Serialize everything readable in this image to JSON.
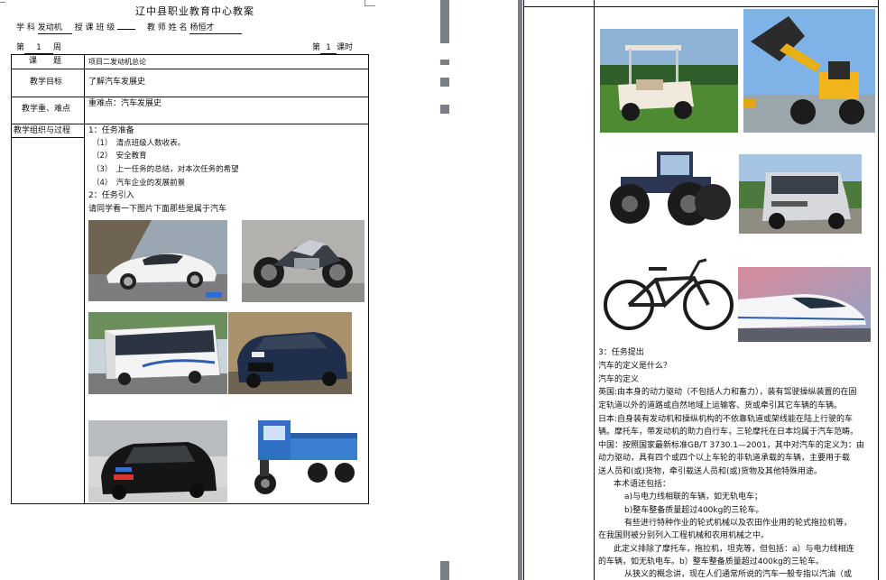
{
  "left_page": {
    "title": "辽中县职业教育中心教案",
    "meta": {
      "subject_label": "学 科",
      "subject_value": "发动机",
      "class_label": "授 课 班 级",
      "class_value": "",
      "teacher_label": "教 师 姓 名",
      "teacher_value": "杨恒才"
    },
    "week": {
      "prefix": "第",
      "value": "1",
      "suffix": "周"
    },
    "period": {
      "prefix": "第",
      "value": "1",
      "suffix": "课时"
    },
    "rows": [
      {
        "label": "课　　题",
        "value": "项目二发动机总论"
      },
      {
        "label": "教学目标",
        "value": "了解汽车发展史"
      },
      {
        "label": "教学重、难点",
        "value": "重难点：汽车发展史"
      },
      {
        "label": "教学组织与过程",
        "value": ""
      }
    ],
    "process": [
      "1：任务准备",
      "（1）　清点班级人数收表。",
      "（2）　安全教育",
      "（3）　上一任务的总结，对本次任务的希望",
      "（4）　汽车企业的发展前景",
      "2：任务引入",
      "请同学看一下图片下面那些是属于汽车"
    ]
  },
  "right_page": {
    "section": "3：任务提出",
    "paragraphs": [
      "汽车的定义是什么？",
      "汽车的定义",
      "英国:由本身的动力驱动（不包括人力和畜力），装有驾驶操纵装置的在固",
      "定轨道以外的道路或自然地域上运输客、货或牵引其它车辆的车辆。",
      "日本:自身装有发动机和操纵机构的不依靠轨道或架线能在陆上行驶的车",
      "辆。摩托车，带发动机的助力自行车，三轮摩托在日本均属于汽车范畴。",
      "中国：按照国家最新标准GB/T 3730.1—2001，其中对汽车的定义为：由",
      "动力驱动，具有四个或四个以上车轮的非轨道承载的车辆，主要用于载",
      "送人员和(或)货物，牵引载送人员和(或)货物及其他特殊用途。",
      "本术语还包括：",
      "a)与电力线相联的车辆，如无轨电车；",
      "b)整车整备质量超过400kg的三轮车。",
      "有些进行特种作业的轮式机械以及农田作业用的轮式拖拉机等，",
      "在我国则被分别列入工程机械和农用机械之中。",
      "此定义排除了摩托车，拖拉机，坦克等，但包括：a）与电力线相连",
      "的车辆，如无轨电车。b）整车整备质量超过400kg的三轮车。",
      "从狭义的概念讲，现在人们通常所说的汽车一般专指以汽油（或"
    ]
  },
  "colors": {
    "page_bg": "#ffffff",
    "text": "#111111",
    "gutter": "#7a7f86"
  },
  "icons": {
    "left_photos": [
      "sports-car",
      "motorcycle",
      "bus",
      "sedan",
      "hatchback",
      "three-wheeler"
    ],
    "right_photos": [
      "golf-cart",
      "wheel-loader",
      "tractor",
      "suv",
      "bicycle",
      "bullet-train"
    ]
  }
}
